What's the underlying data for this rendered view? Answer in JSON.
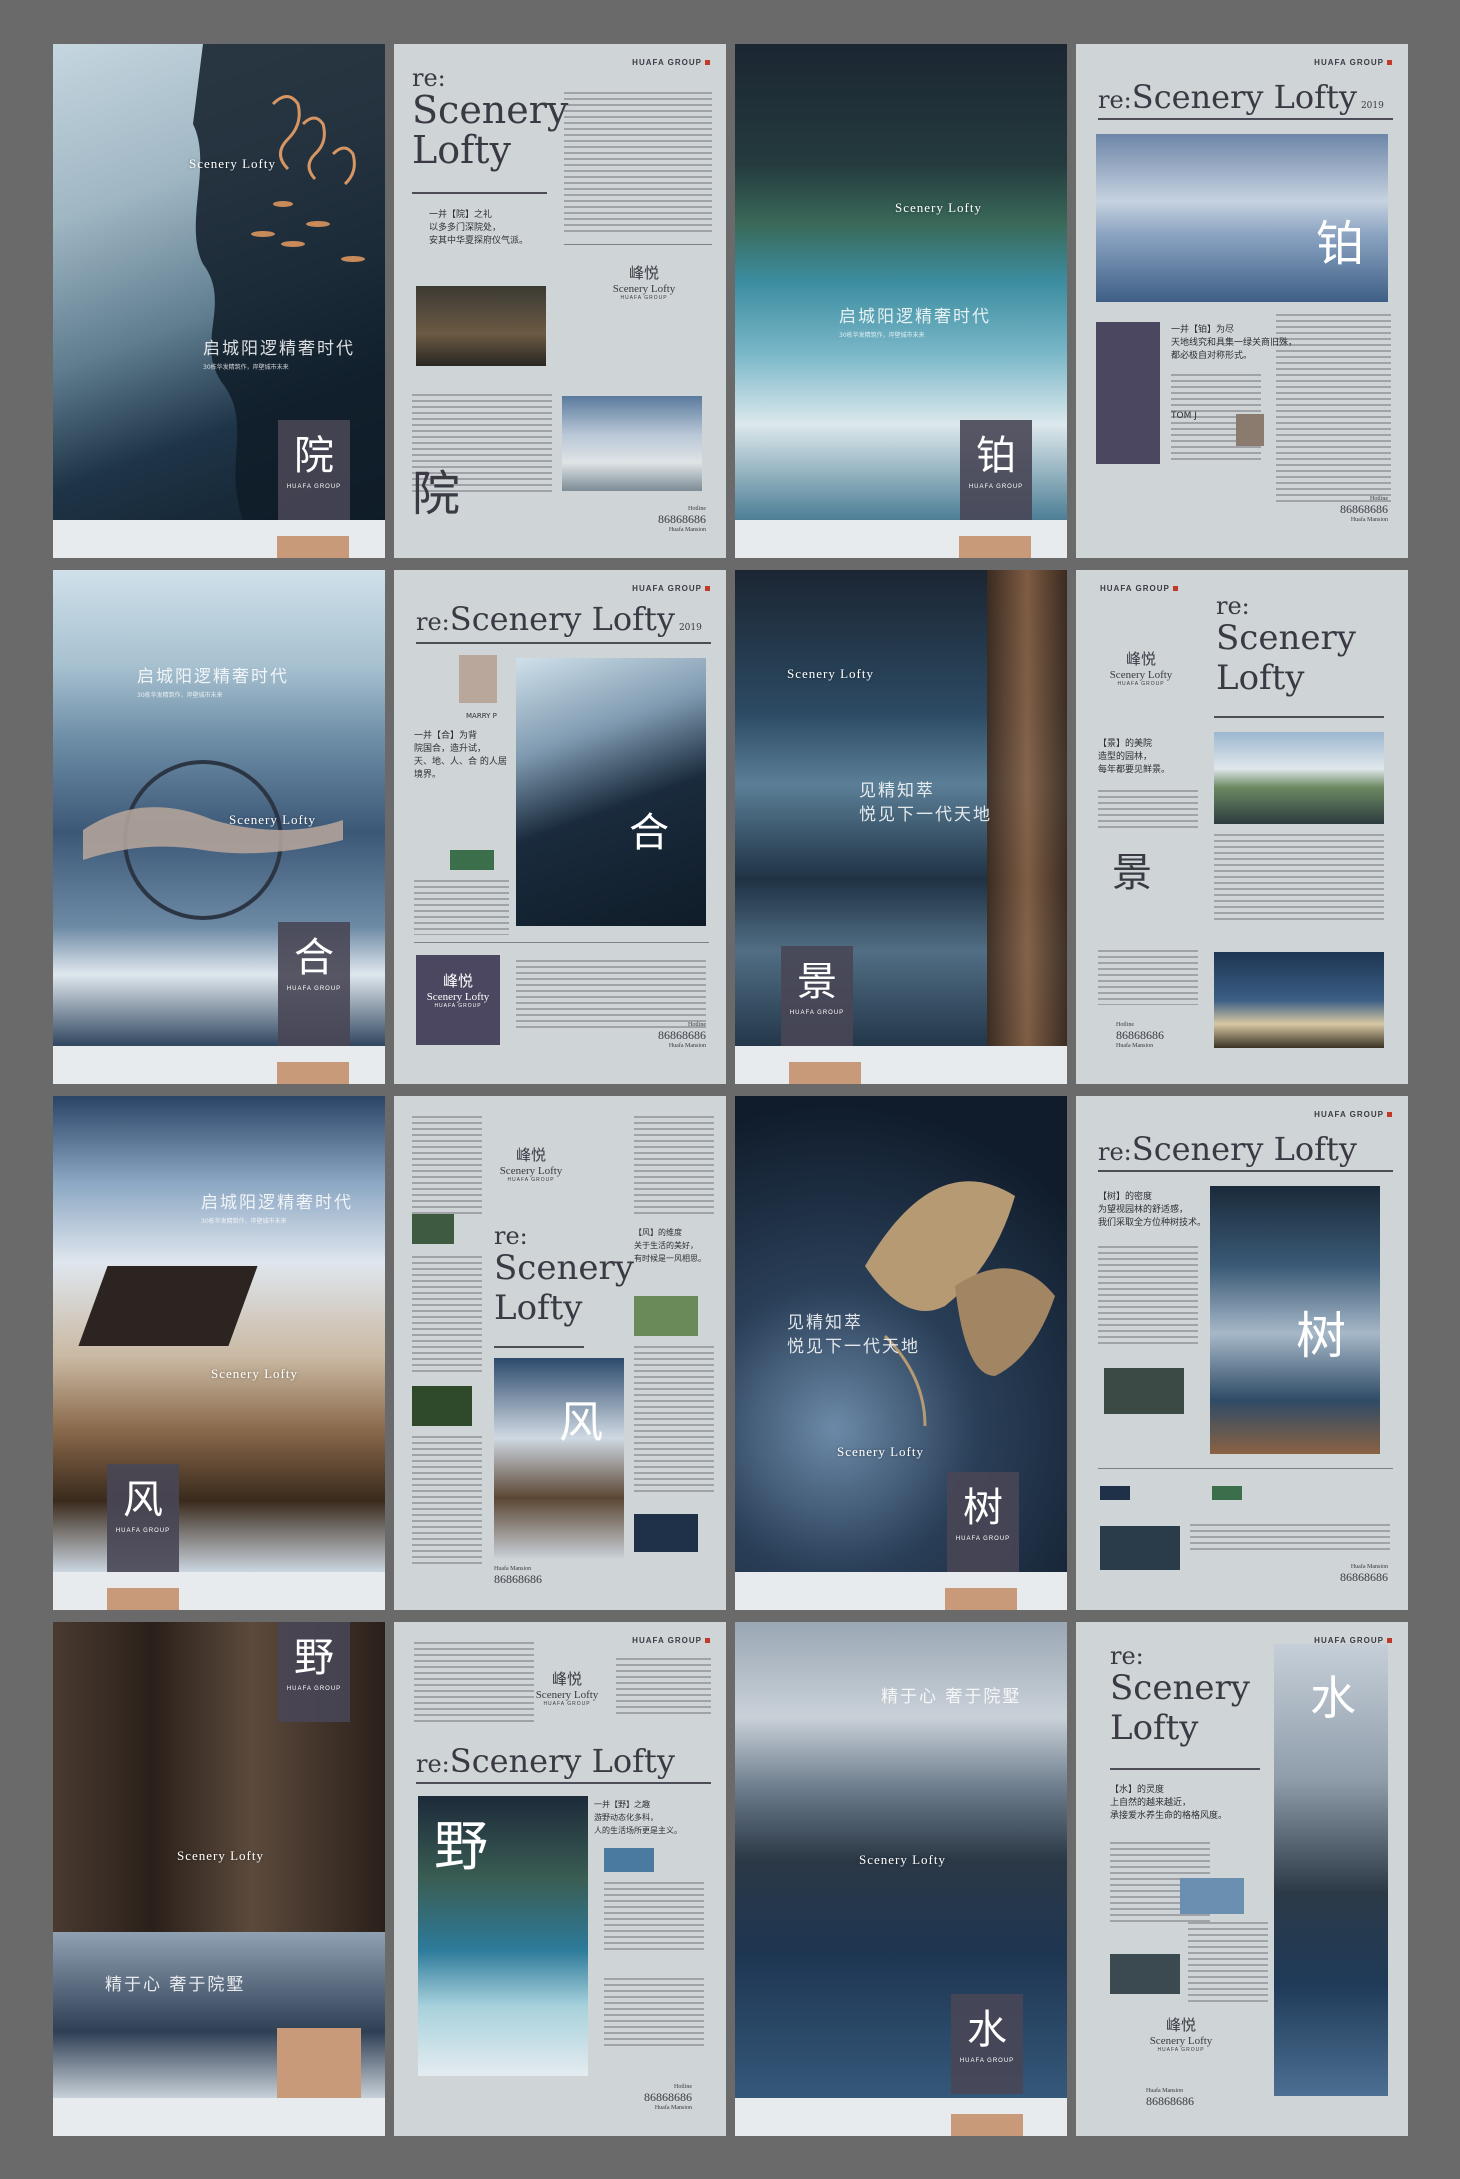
{
  "brand": "HUAFA GROUP",
  "sceneryLofty": "Scenery Lofty",
  "re": "re:",
  "year": "2019",
  "yueLabel": "峰悦",
  "hotline": "Hotline",
  "hotlineNumber": "86868686",
  "mansion": "Huafa Mansion",
  "headline1": "启城阳逻精奢时代",
  "headline1sub": "30栋华发精筑作，岸壁城市未来",
  "headline2": "见精知萃",
  "headline2b": "悦见下一代天地",
  "headline3": "精于心 奢于院墅",
  "chars": {
    "yuan": "院",
    "you": "铂",
    "he": "合",
    "jing": "景",
    "feng": "风",
    "shu": "树",
    "ye": "野",
    "shui": "水"
  },
  "quotes": {
    "yuan": "一并【院】之礼\n以多多门深院处，\n安其中华夏探府仪气派。",
    "you": "一并【铂】为尽\n天地线究和具集一绿关商旧殊，\n都必极自对称形式。",
    "he": "一并【合】为背\n院国合，造升试，\n天、地、人、合 的人居境界。",
    "jing": "【景】的美院\n造型的园林，\n每年都要见鲜景。",
    "feng": "【风】的维度\n关于生活的美好，\n有时候是一风相思。",
    "shu": "【树】的密度\n为望视园林的舒适感，\n我们采取全方位种树技术。",
    "ye": "一并【野】之趣\n游野动态化多科，\n人的生活场所更是主义。",
    "shui": "【水】的灵度\n上自然的越来越近，\n承接爱水养生命的格格风度。"
  },
  "people": {
    "tom": "TOM J",
    "marry": "MARRY P"
  }
}
